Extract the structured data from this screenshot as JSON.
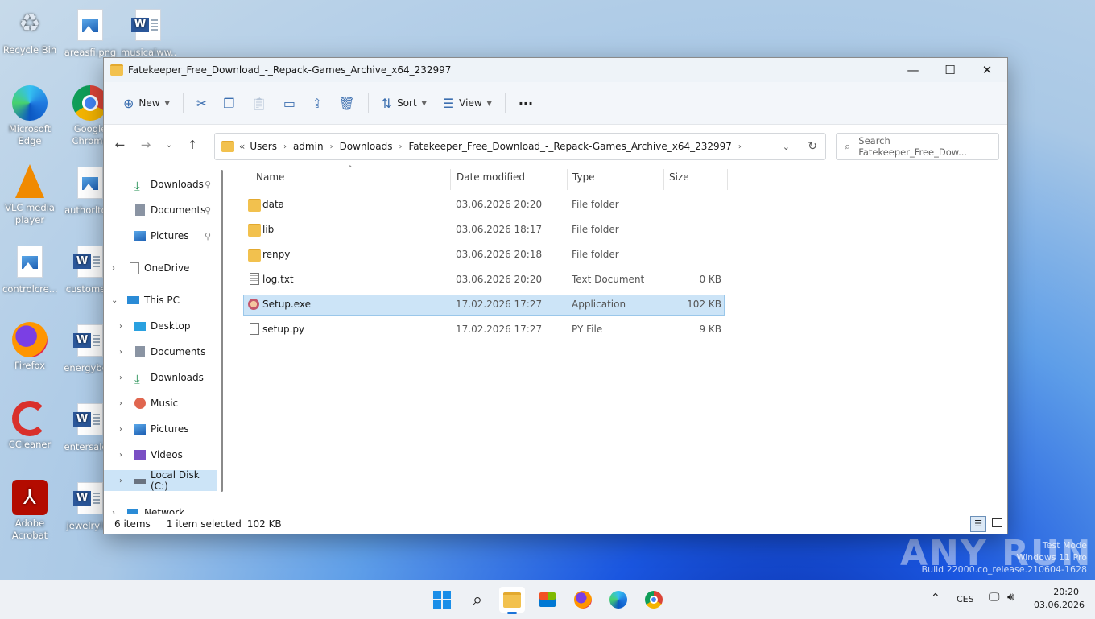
{
  "desktop": {
    "icons": [
      {
        "label": "Recycle Bin"
      },
      {
        "label": "areasfi.png"
      },
      {
        "label": "musicalww..."
      },
      {
        "label": "Microsoft Edge"
      },
      {
        "label": "Google Chrome"
      },
      {
        "label": "VLC media player"
      },
      {
        "label": "authorltd..."
      },
      {
        "label": "controlcre..."
      },
      {
        "label": "custome..."
      },
      {
        "label": "Firefox"
      },
      {
        "label": "energybe..."
      },
      {
        "label": "CCleaner"
      },
      {
        "label": "entersale..."
      },
      {
        "label": "Adobe Acrobat"
      },
      {
        "label": "jewelryli..."
      }
    ]
  },
  "window": {
    "title": "Fatekeeper_Free_Download_-_Repack-Games_Archive_x64_232997",
    "controls": {
      "minimize": "—",
      "maximize": "☐",
      "close": "✕"
    }
  },
  "toolbar": {
    "new_label": "New",
    "sort_label": "Sort",
    "view_label": "View",
    "more_label": "···"
  },
  "address": {
    "overflow": "«",
    "crumbs": [
      "Users",
      "admin",
      "Downloads",
      "Fatekeeper_Free_Download_-_Repack-Games_Archive_x64_232997"
    ],
    "search_placeholder": "Search Fatekeeper_Free_Dow..."
  },
  "navpane": {
    "quick": [
      {
        "label": "Downloads"
      },
      {
        "label": "Documents"
      },
      {
        "label": "Pictures"
      }
    ],
    "onedrive": "OneDrive",
    "thispc": "This PC",
    "pc_items": [
      {
        "label": "Desktop"
      },
      {
        "label": "Documents"
      },
      {
        "label": "Downloads"
      },
      {
        "label": "Music"
      },
      {
        "label": "Pictures"
      },
      {
        "label": "Videos"
      },
      {
        "label": "Local Disk (C:)"
      }
    ],
    "network": "Network"
  },
  "columns": {
    "name": "Name",
    "date": "Date modified",
    "type": "Type",
    "size": "Size"
  },
  "files": [
    {
      "name": "data",
      "date": "03.06.2026 20:20",
      "type": "File folder",
      "size": ""
    },
    {
      "name": "lib",
      "date": "03.06.2026 18:17",
      "type": "File folder",
      "size": ""
    },
    {
      "name": "renpy",
      "date": "03.06.2026 20:18",
      "type": "File folder",
      "size": ""
    },
    {
      "name": "log.txt",
      "date": "03.06.2026 20:20",
      "type": "Text Document",
      "size": "0 KB"
    },
    {
      "name": "Setup.exe",
      "date": "17.02.2026 17:27",
      "type": "Application",
      "size": "102 KB"
    },
    {
      "name": "setup.py",
      "date": "17.02.2026 17:27",
      "type": "PY File",
      "size": "9 KB"
    }
  ],
  "status": {
    "count": "6 items",
    "selected": "1 item selected",
    "size": "102 KB"
  },
  "watermark": {
    "brand": "ANY RUN",
    "line1": "Test Mode",
    "line2": "Windows 11 Pro",
    "line3": "Build 22000.co_release.210604-1628"
  },
  "tray": {
    "lang": "CES",
    "time": "20:20",
    "date": "03.06.2026"
  }
}
